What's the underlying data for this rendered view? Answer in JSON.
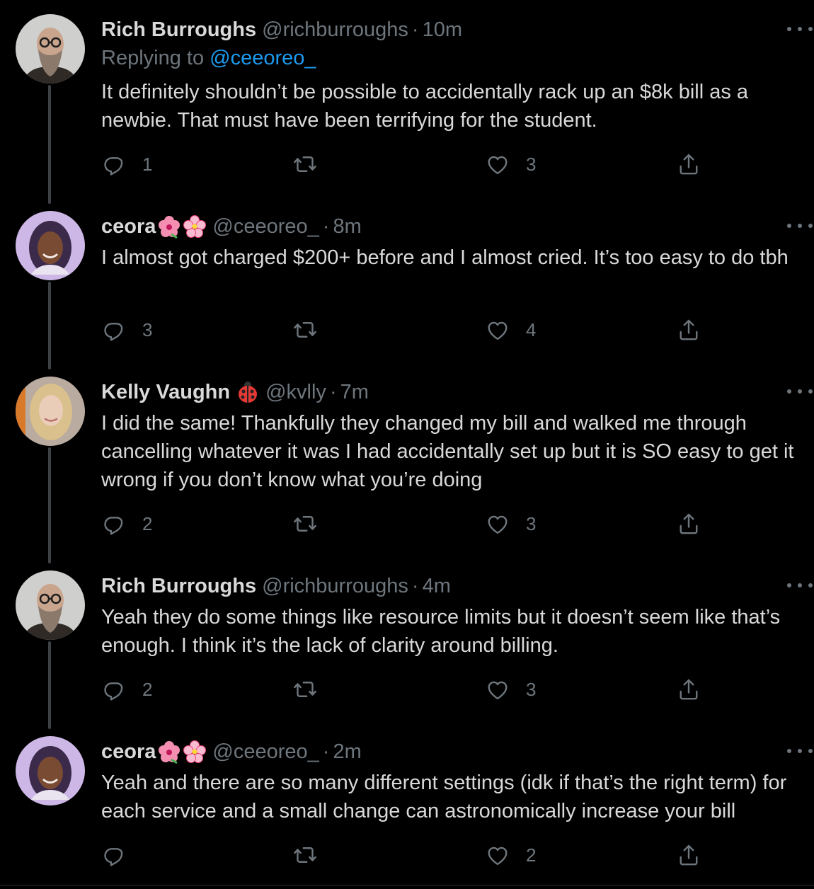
{
  "tweets": [
    {
      "name": "Rich Burroughs",
      "handle": "@richburroughs",
      "time": "10m",
      "replying_prefix": "Replying to ",
      "replying_to": "@ceeoreo_",
      "text": "It definitely shouldn’t be possible to accidentally rack up an $8k bill as a newbie. That must have been terrifying for the student.",
      "replies": "1",
      "retweets": "",
      "likes": "3"
    },
    {
      "name": "ceora",
      "emojis": [
        "hibiscus",
        "cherry-blossom"
      ],
      "handle": "@ceeoreo_",
      "time": "8m",
      "text": "I almost got charged $200+ before and I almost cried. It’s too easy to do tbh",
      "replies": "3",
      "retweets": "",
      "likes": "4"
    },
    {
      "name": "Kelly Vaughn",
      "emojis": [
        "ladybug"
      ],
      "handle": "@kvlly",
      "time": "7m",
      "text": "I did the same! Thankfully they changed my bill and walked me through cancelling whatever it was I had accidentally set up but it is SO easy to get it wrong if you don’t know what you’re doing",
      "replies": "2",
      "retweets": "",
      "likes": "3"
    },
    {
      "name": "Rich Burroughs",
      "handle": "@richburroughs",
      "time": "4m",
      "text": "Yeah they do some things like resource limits but it doesn’t seem like that’s enough. I think it’s the lack of clarity around billing.",
      "replies": "2",
      "retweets": "",
      "likes": "3"
    },
    {
      "name": "ceora",
      "emojis": [
        "hibiscus",
        "cherry-blossom"
      ],
      "handle": "@ceeoreo_",
      "time": "2m",
      "text": "Yeah and there are so many different settings (idk if that’s the right term) for each service and a small change can astronomically increase your bill",
      "replies": "",
      "retweets": "",
      "likes": "2"
    }
  ],
  "separator": "·",
  "icons": {
    "reply": "reply-icon",
    "retweet": "retweet-icon",
    "like": "heart-icon",
    "share": "share-icon",
    "more": "more-icon"
  },
  "colors": {
    "background": "#000000",
    "text": "#d9d9d9",
    "muted": "#6e767d",
    "link": "#1d9bf0",
    "thread_line": "#3d4146"
  }
}
